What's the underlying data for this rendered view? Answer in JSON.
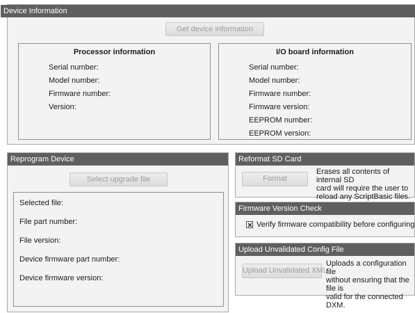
{
  "device_info": {
    "header": "Device Information",
    "get_button": "Get device information",
    "processor": {
      "title": "Processor information",
      "labels": [
        "Serial number:",
        "Model number:",
        "Firmware number:",
        "Version:"
      ]
    },
    "io_board": {
      "title": "I/O board information",
      "labels": [
        "Serial number:",
        "Model number:",
        "Firmware number:",
        "Firmware version:",
        "EEPROM number:",
        "EEPROM version:"
      ]
    }
  },
  "reprogram": {
    "header": "Reprogram Device",
    "select_button": "Select upgrade file",
    "labels": [
      "Selected file:",
      "File part number:",
      "File version:",
      "Device firmware part number:",
      "Device firmware version:"
    ]
  },
  "reformat": {
    "header": "Reformat SD Card",
    "format_button": "Format",
    "description": "Erases all contents of internal SD\ncard will require the user to\nreload any ScriptBasic files."
  },
  "firmware_check": {
    "header": "Firmware Version Check",
    "checkbox_label": "Verify firmware compatibility before configuring DXM",
    "checked": true
  },
  "upload": {
    "header": "Upload Unvalidated Config File",
    "button": "Upload Unvalidated XML",
    "description": "Uploads a configuration file\nwithout ensuring that the file is\nvalid for the connected DXM."
  }
}
